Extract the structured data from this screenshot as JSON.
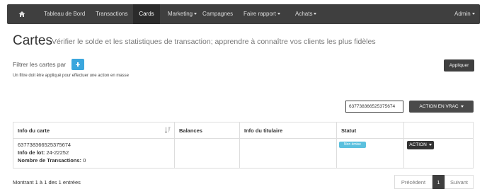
{
  "nav": {
    "items": [
      {
        "label": "Tableau de Bord"
      },
      {
        "label": "Transactions"
      },
      {
        "label": "Cards"
      },
      {
        "label": "Marketing"
      },
      {
        "label": "Campagnes"
      },
      {
        "label": "Faire rapport"
      },
      {
        "label": "Achats"
      }
    ],
    "active": "Cards",
    "user_menu": "Admin"
  },
  "header": {
    "title": "Cartes",
    "subtitle": "Vérifier le solde et les statistiques de transaction; apprendre à connaître vos clients les plus fidèles"
  },
  "filter": {
    "label": "Filtrer les cartes par",
    "note": "Un filtre doit être appliqué pour effectuer une action en masse",
    "apply_label": "Appliquer"
  },
  "search": {
    "value": "637738366525375674"
  },
  "bulk_action": {
    "label": "ACTION EN VRAC"
  },
  "table": {
    "columns": [
      "Info du carte",
      "Balances",
      "Info du titulaire",
      "Statut",
      ""
    ],
    "rows": [
      {
        "card_number": "637738366525375674",
        "lot_label": "Info de lot:",
        "lot_value": "24-22252",
        "tx_label": "Nombre de Transactions:",
        "tx_value": "0",
        "balances": "",
        "holder_info": "",
        "status": "Non émise",
        "action_label": "ACTION"
      }
    ]
  },
  "footer": {
    "entries_text": "Montrant 1 à 1 des 1 entrées",
    "prev_label": "Précédent",
    "current_page": "1",
    "next_label": "Suivant"
  },
  "colors": {
    "nav_bg": "#3f3f3f",
    "accent_blue": "#3aa6dd",
    "badge_info": "#5bc0de",
    "dark_button": "#3f3f3f"
  }
}
